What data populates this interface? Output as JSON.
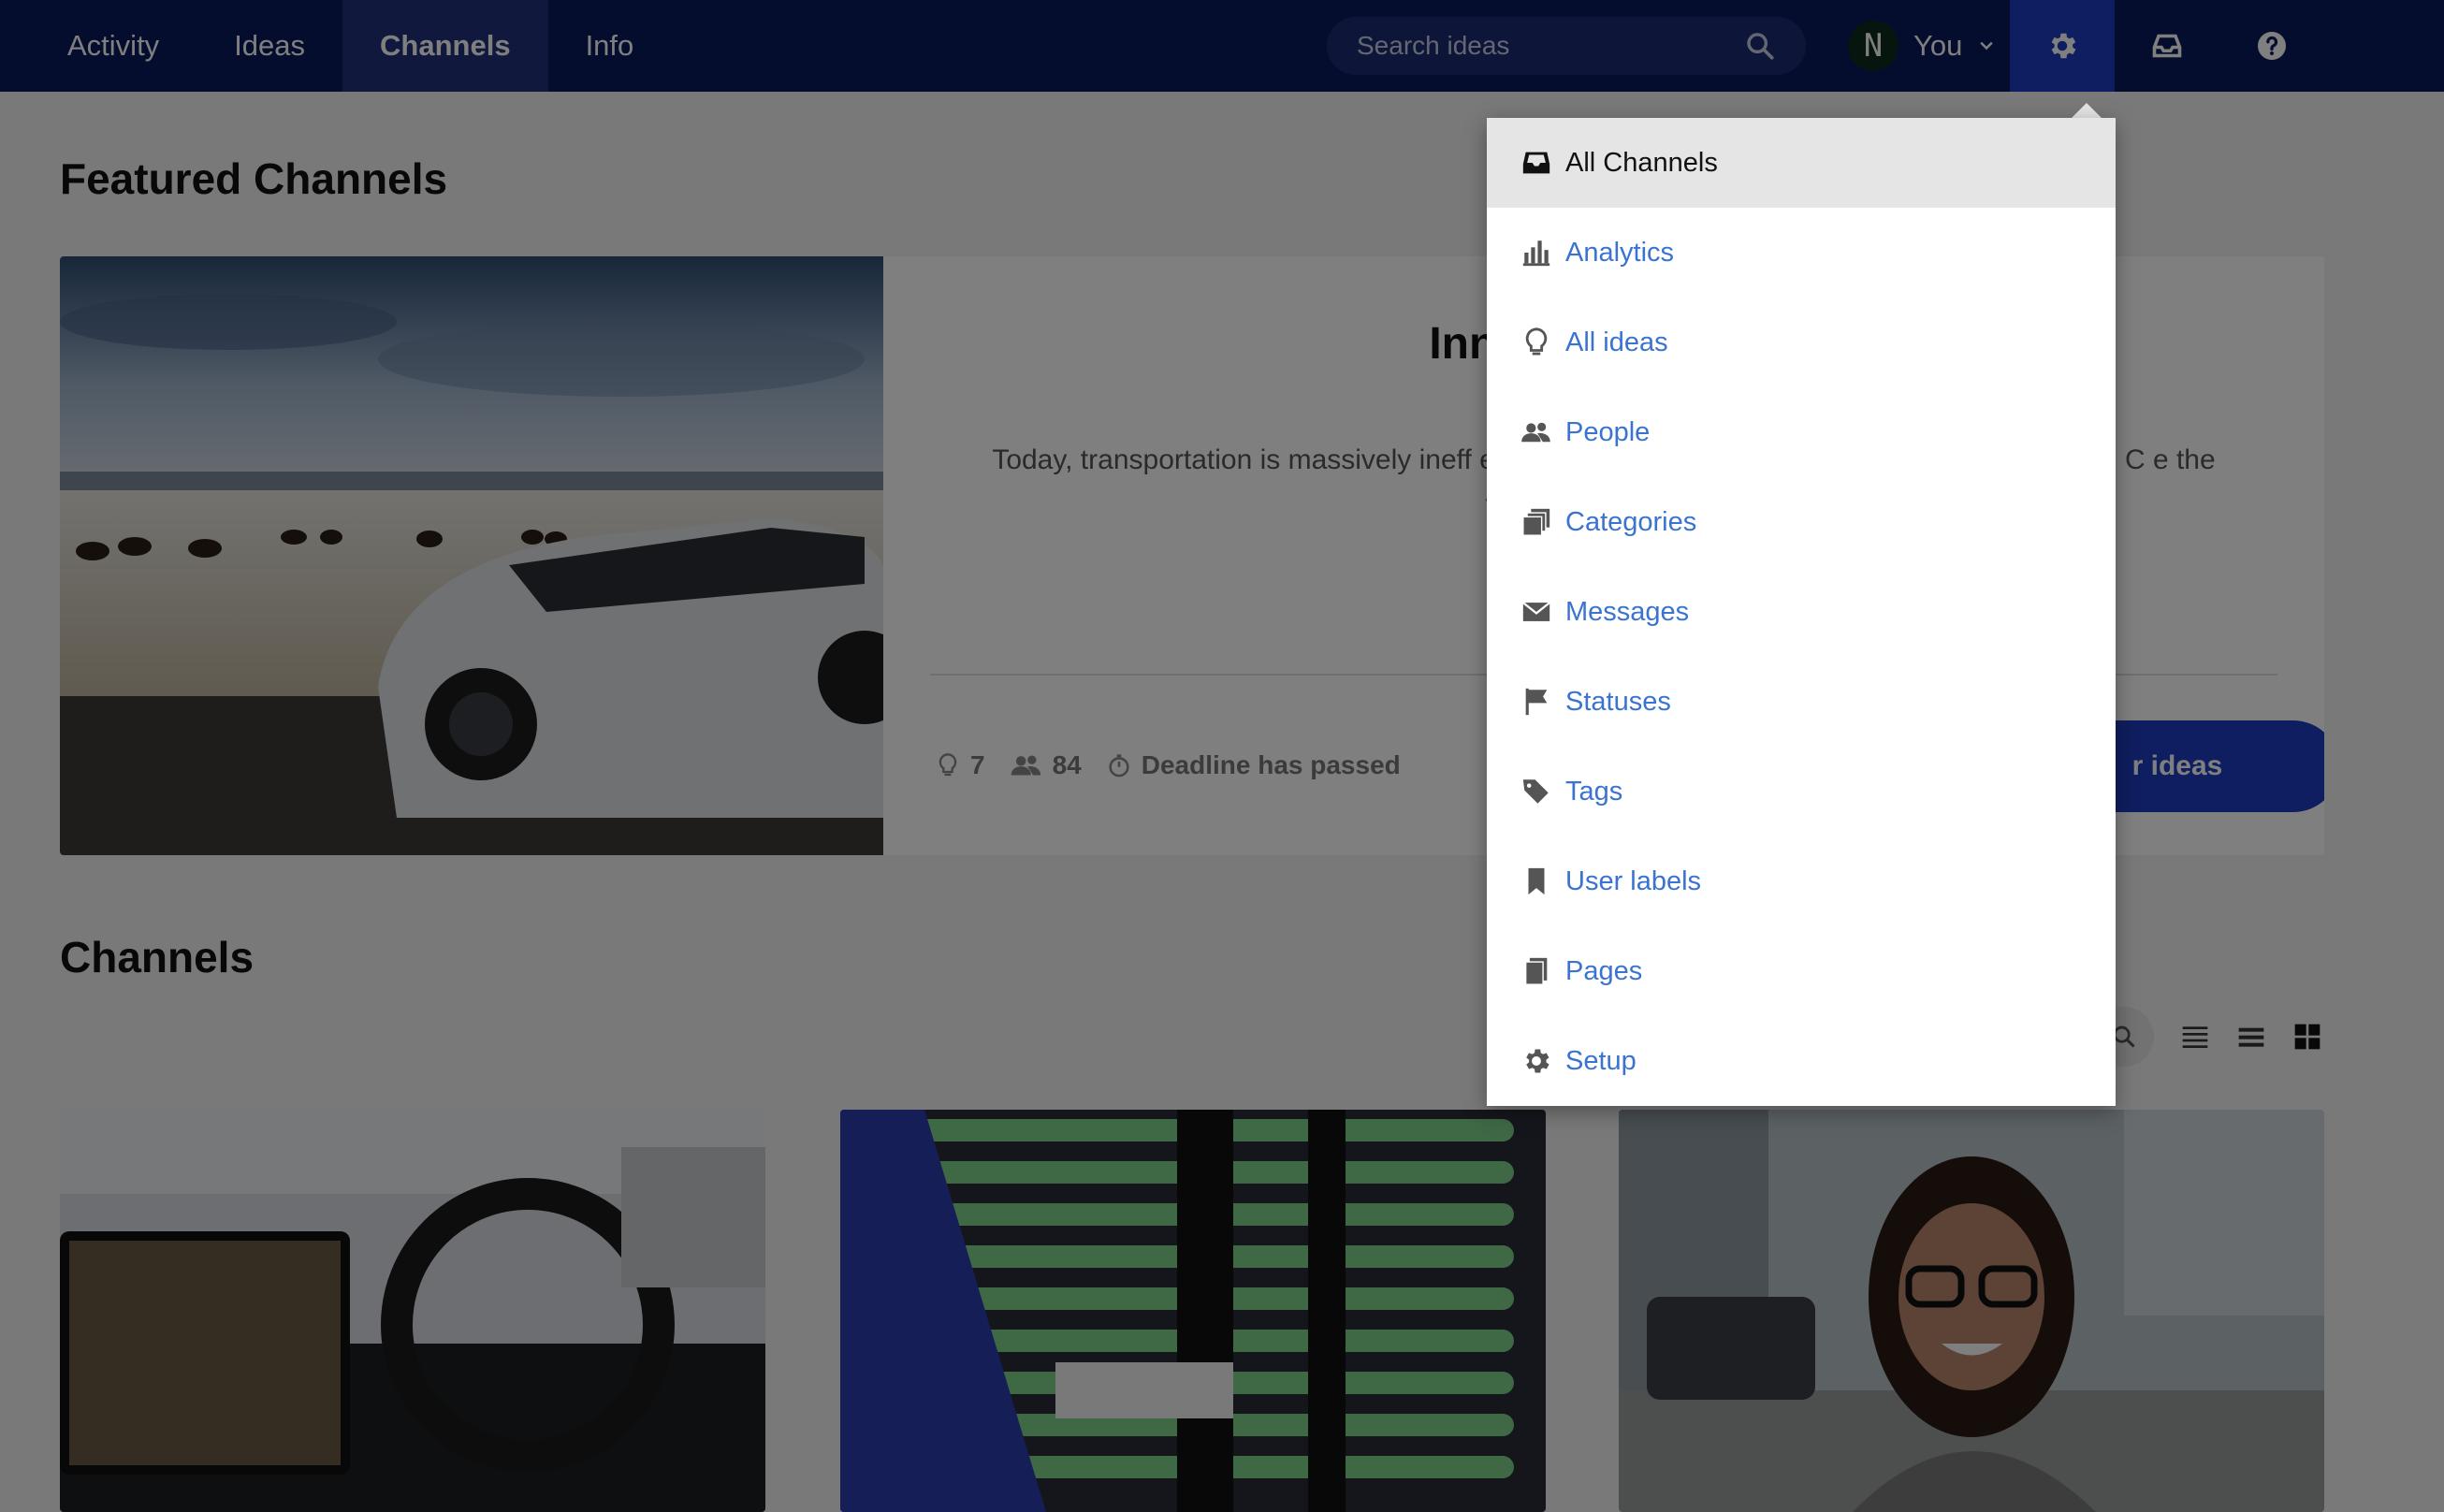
{
  "nav": {
    "tabs": [
      {
        "label": "Activity"
      },
      {
        "label": "Ideas"
      },
      {
        "label": "Channels",
        "active": true
      },
      {
        "label": "Info"
      }
    ],
    "search_placeholder": "Search ideas",
    "user": {
      "initial": "N",
      "name": "You"
    },
    "icons": [
      "gear-icon",
      "inbox-icon",
      "help-icon"
    ]
  },
  "featured": {
    "heading": "Featured Channels",
    "card": {
      "title": "Innovation Chall",
      "description": "Today, transportation is massively ineff                                                            ent. We at AMPERE are on the forefront of change. C                                                       e the future of mobility. A",
      "ideas_count": "7",
      "members_count": "84",
      "deadline": "Deadline has passed",
      "cta_label": "r ideas"
    }
  },
  "channels": {
    "heading": "Channels"
  },
  "dropdown": {
    "items": [
      {
        "label": "All Channels",
        "icon": "inbox-icon",
        "active": true
      },
      {
        "label": "Analytics",
        "icon": "bar-chart-icon"
      },
      {
        "label": "All ideas",
        "icon": "lightbulb-icon"
      },
      {
        "label": "People",
        "icon": "people-icon"
      },
      {
        "label": "Categories",
        "icon": "categories-icon"
      },
      {
        "label": "Messages",
        "icon": "envelope-icon"
      },
      {
        "label": "Statuses",
        "icon": "flag-icon"
      },
      {
        "label": "Tags",
        "icon": "tags-icon"
      },
      {
        "label": "User labels",
        "icon": "bookmark-icon"
      },
      {
        "label": "Pages",
        "icon": "pages-icon"
      },
      {
        "label": "Setup",
        "icon": "gear-icon"
      }
    ]
  },
  "colors": {
    "nav_bg": "#0a1a5c",
    "nav_active": "#23307a",
    "accent": "#1f3cc0",
    "link": "#3a73d0"
  }
}
